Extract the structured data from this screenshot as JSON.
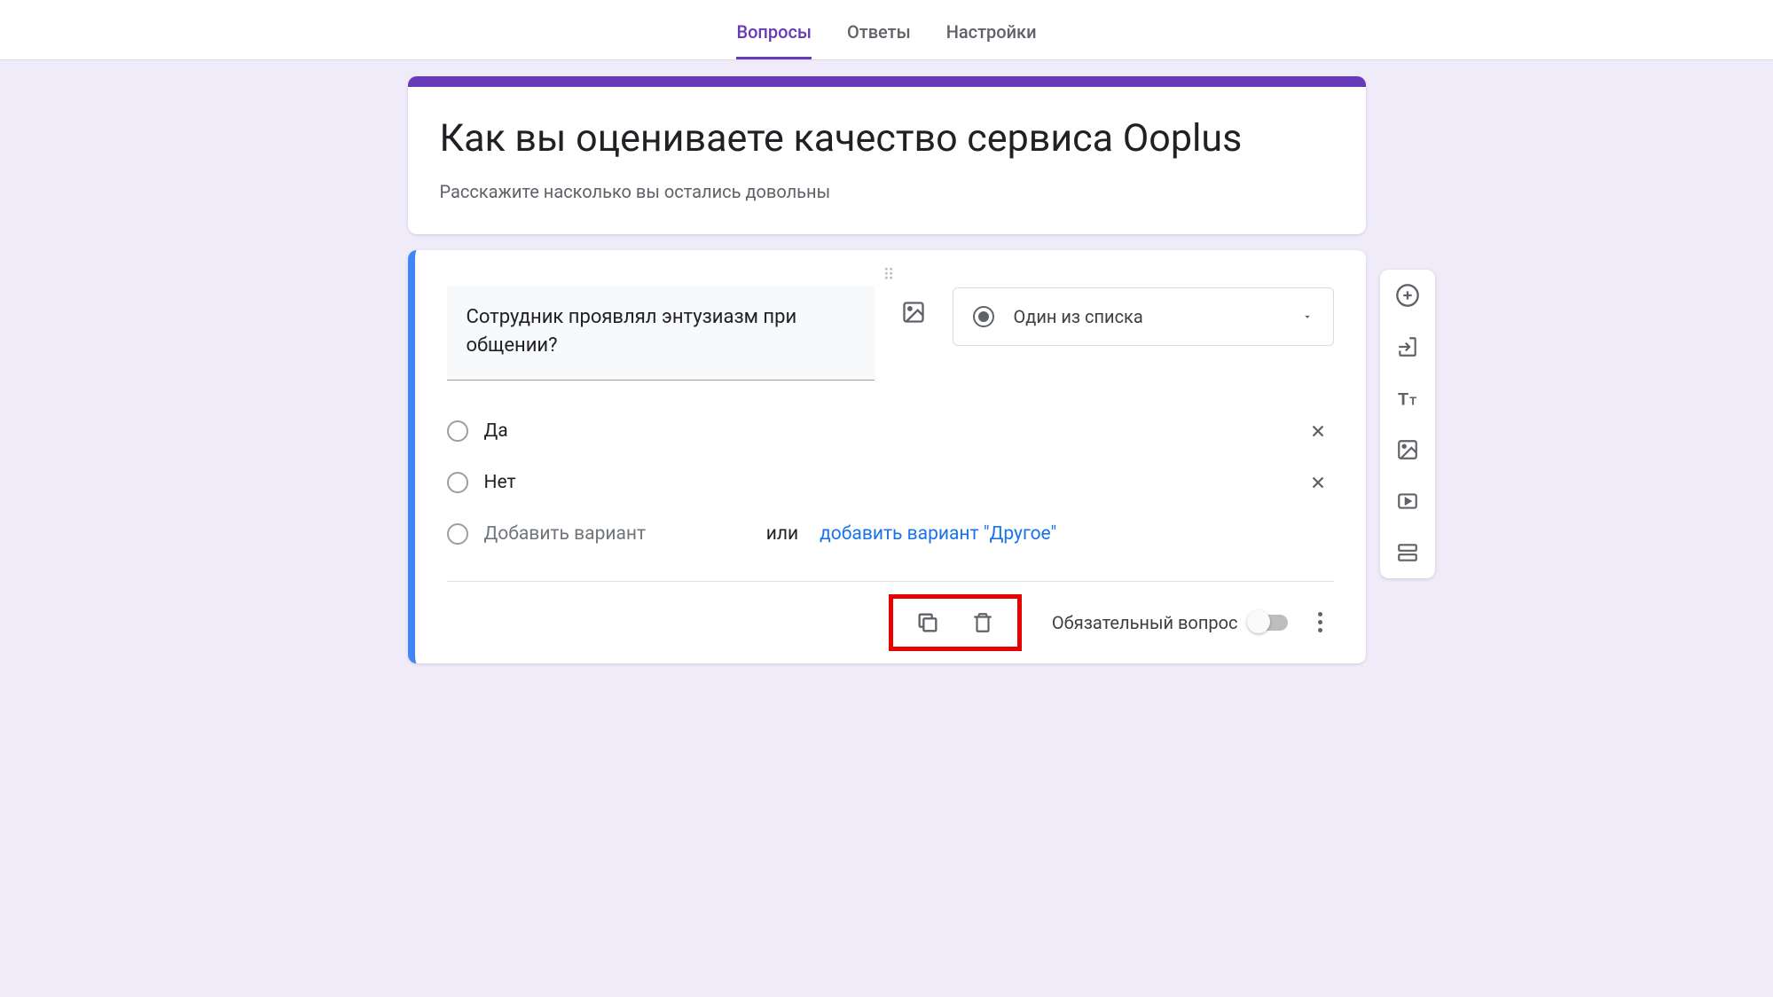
{
  "tabs": {
    "questions": "Вопросы",
    "responses": "Ответы",
    "settings": "Настройки"
  },
  "form": {
    "title": "Как вы оцениваете качество сервиса Ooplus",
    "description": "Расскажите насколько вы остались довольны"
  },
  "question": {
    "text": "Сотрудник проявлял энтузиазм при общении?",
    "type_label": "Один из списка",
    "options": [
      "Да",
      "Нет"
    ],
    "add_option_placeholder": "Добавить вариант",
    "or_label": "или",
    "add_other_label": "добавить вариант \"Другое\"",
    "required_label": "Обязательный вопрос"
  },
  "icons": {
    "image": "image-icon",
    "remove": "close-icon",
    "duplicate": "duplicate-icon",
    "delete": "trash-icon",
    "add_question": "plus-circle-icon",
    "import": "import-icon",
    "title_desc": "text-icon",
    "add_image": "image-icon",
    "add_video": "video-icon",
    "add_section": "section-icon"
  }
}
